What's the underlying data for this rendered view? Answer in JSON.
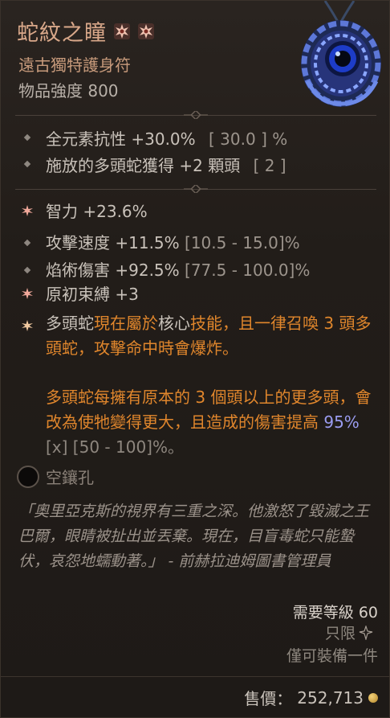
{
  "item": {
    "name": "蛇紋之瞳",
    "type": "遠古獨特護身符",
    "power_label": "物品強度",
    "power_value": "800"
  },
  "implicits": [
    {
      "text": "全元素抗性 +30.0%",
      "range": "[ 30.0 ] %"
    },
    {
      "text": "施放的多頭蛇獲得 +2 顆頭",
      "range": "[ 2 ]"
    }
  ],
  "affixes": [
    {
      "icon": "greater-affix-star-icon",
      "text": "智力 +23.6%",
      "range": ""
    },
    {
      "icon": "dot-icon",
      "text": "攻擊速度 +11.5%",
      "range": "[10.5 - 15.0]%"
    },
    {
      "icon": "dot-icon",
      "text": "焰術傷害 +92.5%",
      "range": "[77.5 - 100.0]%"
    },
    {
      "icon": "greater-affix-star-icon",
      "text": "原初束縛 +3",
      "range": ""
    }
  ],
  "legendary": {
    "p1_a": "多頭蛇",
    "p1_b": "現在屬於",
    "p1_c": "核心",
    "p1_d": "技能",
    "p1_e": "，且一律召喚 3 頭多頭蛇，攻擊命中時會爆炸。",
    "p2_a": "多頭蛇每擁有原本的 3 個頭以上的更多頭，會改為使牠變得更大，且造成的傷害提高 ",
    "p2_value": "95%",
    "p2_x": "[x]",
    "p2_range": " [50 - 100]%。"
  },
  "socket_label": "空鑲孔",
  "flavor": "「奧里亞克斯的視界有三重之深。他激怒了毀滅之王巴爾，眼睛被扯出並丟棄。現在，目盲毒蛇只能蟄伏，哀怨地蠕動著。」 - 前赫拉迪姆圖書管理員",
  "requirements": {
    "level": "需要等級 60",
    "class": "只限",
    "unique_equipped": "僅可裝備一件"
  },
  "sell": {
    "label": "售價：",
    "value": "252,713"
  },
  "colors": {
    "title": "#d9a88a",
    "legendary_orange": "#e0862c",
    "roll_blue": "#9a9cf0"
  }
}
